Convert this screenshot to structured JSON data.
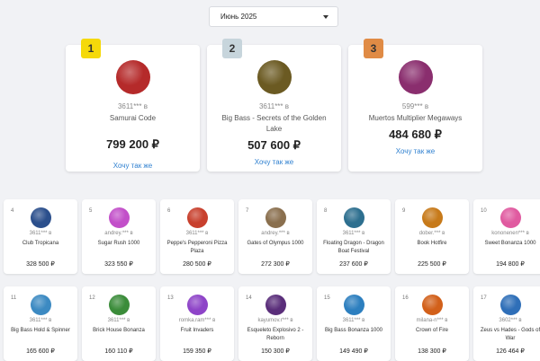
{
  "month_select": {
    "value": "Июнь 2025"
  },
  "podium": [
    {
      "rank": "1",
      "badge_color": "#f5d90a",
      "user": "3611*** в",
      "game": "Samurai Code",
      "amount": "799 200 ₽",
      "link": "Хочу так же",
      "avatar_color": "#b52a2a",
      "icon": "samurai-code-game-icon"
    },
    {
      "rank": "2",
      "badge_color": "#c7d5dc",
      "user": "3611*** в",
      "game": "Big Bass - Secrets of the Golden Lake",
      "amount": "507 600 ₽",
      "link": "Хочу так же",
      "avatar_color": "#6b5a22",
      "icon": "big-bass-secrets-game-icon"
    },
    {
      "rank": "3",
      "badge_color": "#e08b45",
      "user": "599*** в",
      "game": "Muertos Multiplier Megaways",
      "amount": "484 680 ₽",
      "link": "Хочу так же",
      "avatar_color": "#8a2e6e",
      "icon": "muertos-multiplier-game-icon"
    }
  ],
  "winners": [
    {
      "num": "4",
      "user": "3611*** в",
      "game": "Club Tropicana",
      "amount": "328 500 ₽",
      "avatar_color": "#2b4f8c",
      "icon": "club-tropicana-game-icon"
    },
    {
      "num": "5",
      "user": "andrey.*** в",
      "game": "Sugar Rush 1000",
      "amount": "323 550 ₽",
      "avatar_color": "#c24fc9",
      "icon": "sugar-rush-game-icon"
    },
    {
      "num": "6",
      "user": "3611*** в",
      "game": "Peppe's Pepperoni Pizza Plaza",
      "amount": "280 500 ₽",
      "avatar_color": "#c8402d",
      "icon": "pepperoni-pizza-game-icon"
    },
    {
      "num": "7",
      "user": "andrey.*** в",
      "game": "Gates of Olympus 1000",
      "amount": "272 300 ₽",
      "avatar_color": "#8a6f4e",
      "icon": "gates-of-olympus-game-icon"
    },
    {
      "num": "8",
      "user": "3611*** в",
      "game": "Floating Dragon - Dragon Boat Festival",
      "amount": "237 600 ₽",
      "avatar_color": "#2d6f8f",
      "icon": "floating-dragon-game-icon"
    },
    {
      "num": "9",
      "user": "dober.*** в",
      "game": "Book Hotfire",
      "amount": "225 500 ₽",
      "avatar_color": "#c77a1a",
      "icon": "book-hotfire-game-icon"
    },
    {
      "num": "10",
      "user": "kononenen*** в",
      "game": "Sweet Bonanza 1000",
      "amount": "194 800 ₽",
      "avatar_color": "#e05aa0",
      "icon": "sweet-bonanza-game-icon"
    },
    {
      "num": "11",
      "user": "3611*** в",
      "game": "Big Bass Hold & Spinner",
      "amount": "165 600 ₽",
      "avatar_color": "#3c8ac2",
      "icon": "big-bass-hold-spinner-game-icon"
    },
    {
      "num": "12",
      "user": "3611*** в",
      "game": "Brick House Bonanza",
      "amount": "160 110 ₽",
      "avatar_color": "#3b8c3a",
      "icon": "brick-house-game-icon"
    },
    {
      "num": "13",
      "user": "romka.ram*** в",
      "game": "Fruit Invaders",
      "amount": "159 350 ₽",
      "avatar_color": "#8e44c8",
      "icon": "fruit-invaders-game-icon"
    },
    {
      "num": "14",
      "user": "kayumov.r*** в",
      "game": "Esqueleto Explosivo 2 - Reborn",
      "amount": "150 300 ₽",
      "avatar_color": "#5a2e7a",
      "icon": "esqueleto-explosivo-game-icon"
    },
    {
      "num": "15",
      "user": "3611*** в",
      "game": "Big Bass Bonanza 1000",
      "amount": "149 490 ₽",
      "avatar_color": "#2d7fbf",
      "icon": "big-bass-bonanza-game-icon"
    },
    {
      "num": "16",
      "user": "milana-n*** в",
      "game": "Crown of Fire",
      "amount": "138 300 ₽",
      "avatar_color": "#d2601a",
      "icon": "crown-of-fire-game-icon"
    },
    {
      "num": "17",
      "user": "3602*** в",
      "game": "Zeus vs Hades - Gods of War",
      "amount": "126 464 ₽",
      "avatar_color": "#2f6fb8",
      "icon": "zeus-vs-hades-game-icon"
    }
  ]
}
